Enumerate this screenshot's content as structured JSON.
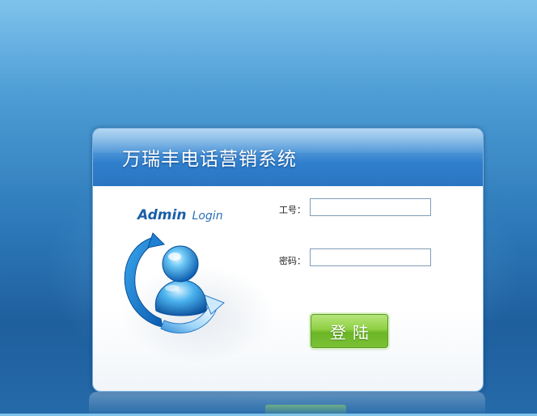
{
  "window": {
    "title": "万瑞丰电话营销系统"
  },
  "brand": {
    "admin": "Admin",
    "login": "Login"
  },
  "form": {
    "employee_id_label": "工号：",
    "employee_id_value": "",
    "password_label": "密码：",
    "password_value": ""
  },
  "actions": {
    "login_label": "登陆"
  },
  "icons": {
    "logo": "user-refresh-icon"
  },
  "colors": {
    "header": "#2f7fcc",
    "button": "#7cc137",
    "brand": "#1b5fa8"
  }
}
